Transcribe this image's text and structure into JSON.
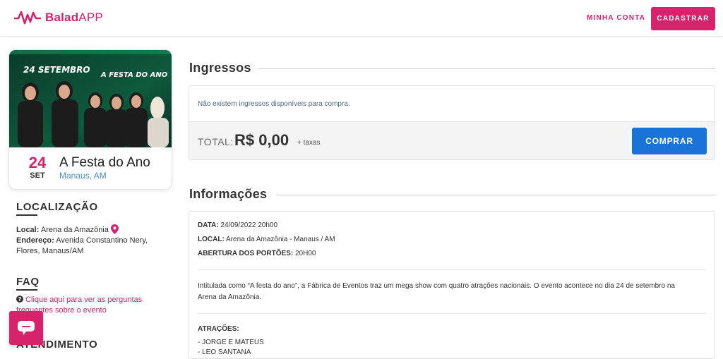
{
  "header": {
    "logo_bold": "Balad",
    "logo_light": "APP",
    "my_account": "MINHA CONTA",
    "signup": "CADASTRAR"
  },
  "event": {
    "banner_date": "24 SETEMBRO",
    "banner_title": "A FESTA DO ANO",
    "day": "24",
    "month": "SET",
    "name": "A Festa do Ano",
    "city": "Manaus, AM"
  },
  "sidebar": {
    "location_title": "LOCALIZAÇÃO",
    "local_label": "Local:",
    "local_value": "Arena da Amazônia",
    "address_label": "Endereço:",
    "address_value": "Avenida Constantino Nery, Flores, Manaus/AM",
    "faq_title": "FAQ",
    "faq_link": "Clique aqui para ver as perguntas frequentes sobre o evento",
    "support_title": "ATENDIMENTO"
  },
  "tickets": {
    "title": "Ingressos",
    "empty_message": "Não existem ingressos disponíveis para compra.",
    "total_label": "TOTAL:",
    "total_value": "R$ 0,00",
    "tax_note": "+ taxas",
    "buy": "COMPRAR"
  },
  "info": {
    "title": "Informações",
    "date_label": "DATA:",
    "date_value": "24/09/2022 20h00",
    "local_label": "LOCAL:",
    "local_value": "Arena da Amazônia - Manaus / AM",
    "gates_label": "ABERTURA DOS PORTÕES:",
    "gates_value": "20H00",
    "description": "Intitulada como “A festa do ano”, a Fábrica de Eventos traz um mega show com quatro atrações nacionais. O evento acontece no dia 24 de setembro na Arena da Amazônia.",
    "attractions_label": "ATRAÇÕES:",
    "attractions": [
      "- JORGE E MATEUS",
      "- LEO SANTANA"
    ]
  },
  "colors": {
    "brand": "#d6236c",
    "buy_button": "#1a73d9",
    "link_blue": "#4a8fd1"
  },
  "icons": [
    "logo-wave-icon",
    "location-pin-icon",
    "question-icon",
    "chat-icon"
  ]
}
